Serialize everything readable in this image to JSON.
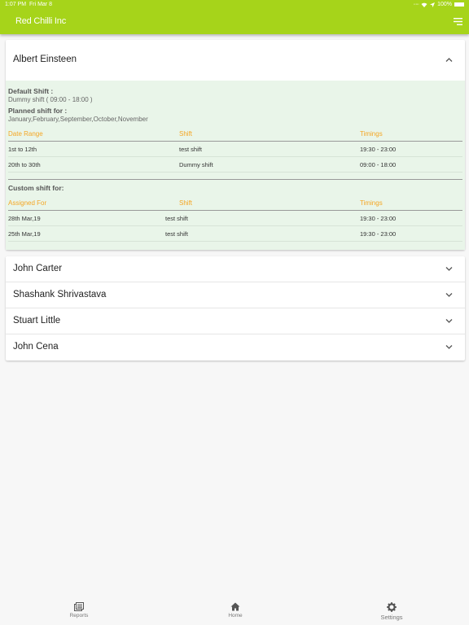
{
  "status_bar": {
    "time": "1:07 PM",
    "date": "Fri Mar 8",
    "battery": "100%"
  },
  "app_bar": {
    "title": "Red Chilli Inc",
    "color": "#a6d41a"
  },
  "employees": [
    {
      "name": "Albert Einsteen",
      "expanded": true,
      "default_shift_label": "Default Shift :",
      "default_shift_value": "Dummy shift ( 09:00 - 18:00 )",
      "planned_label": "Planned shift for :",
      "planned_months": "January,February,September,October,November",
      "planned_table": {
        "headers": [
          "Date Range",
          "Shift",
          "Timings"
        ],
        "rows": [
          [
            "1st to 12th",
            "test shift",
            "19:30 - 23:00"
          ],
          [
            "20th to 30th",
            "Dummy shift",
            "09:00 - 18:00"
          ]
        ]
      },
      "custom_label": "Custom shift for:",
      "custom_table": {
        "headers": [
          "Assigned For",
          "Shift",
          "Timings"
        ],
        "rows": [
          [
            "28th Mar,19",
            "test shift",
            "19:30 - 23:00"
          ],
          [
            "25th Mar,19",
            "test shift",
            "19:30 - 23:00"
          ]
        ]
      }
    },
    {
      "name": "John Carter",
      "expanded": false
    },
    {
      "name": "Shashank Shrivastava",
      "expanded": false
    },
    {
      "name": "Stuart Little",
      "expanded": false
    },
    {
      "name": "John Cena",
      "expanded": false
    }
  ],
  "tabs": [
    {
      "label": "Reports",
      "icon": "reports-icon"
    },
    {
      "label": "Home",
      "icon": "home-icon"
    },
    {
      "label": "Settings",
      "icon": "settings-icon"
    }
  ]
}
